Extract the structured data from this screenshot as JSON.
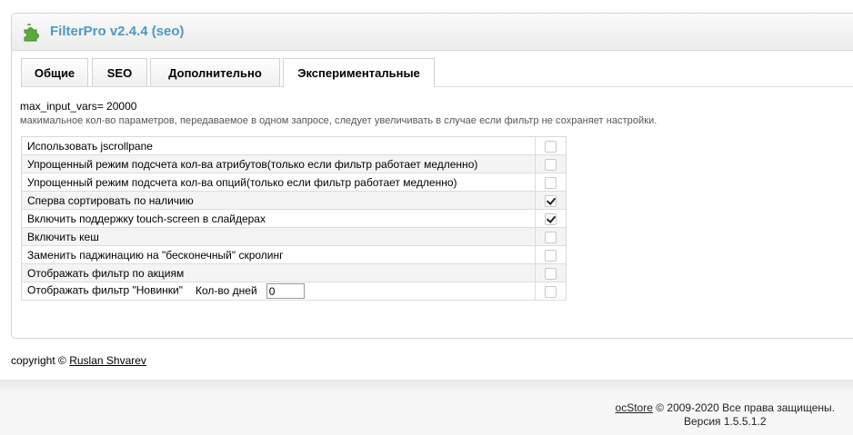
{
  "panel": {
    "title": "FilterPro v2.4.4 (seo)",
    "icon": "puzzle-icon",
    "accent_color": "#4b9ac4"
  },
  "tabs": [
    {
      "label": "Общие",
      "active": false
    },
    {
      "label": "SEO",
      "active": false
    },
    {
      "label": "Дополнительно",
      "active": false
    },
    {
      "label": "Экспериментальные",
      "active": true
    }
  ],
  "info": {
    "max_input_vars": "max_input_vars= 20000",
    "note": "макимальное кол-во параметров, передаваемое в одном запросе, следует увеличивать в случае если фильтр не сохраняет настройки."
  },
  "options": [
    {
      "label": "Использовать jscrollpane",
      "checked": false
    },
    {
      "label": "Упрощенный режим подсчета кол-ва атрибутов(только если фильтр работает медленно)",
      "checked": false
    },
    {
      "label": "Упрощенный режим подсчета кол-ва опций(только если фильтр работает медленно)",
      "checked": false
    },
    {
      "label": "Сперва сортировать по наличию",
      "checked": true
    },
    {
      "label": "Включить поддержку touch-screen в слайдерах",
      "checked": true
    },
    {
      "label": "Включить кеш",
      "checked": false
    },
    {
      "label": "Заменить паджинацию на \"бесконечный\" скролинг",
      "checked": false
    },
    {
      "label": "Отображать фильтр по акциям",
      "checked": false
    },
    {
      "label": "Отображать фильтр \"Новинки\"",
      "checked": false,
      "days_label": "Кол-во дней",
      "days_value": "0"
    }
  ],
  "copyright": {
    "prefix": "copyright ©",
    "author": "Ruslan Shvarev"
  },
  "footer": {
    "brand": "ocStore",
    "rights": "© 2009-2020 Все права защищены.",
    "version": "Версия 1.5.5.1.2"
  }
}
